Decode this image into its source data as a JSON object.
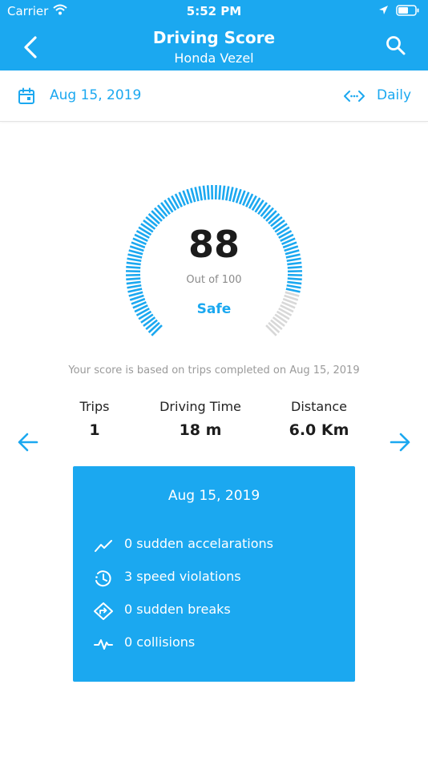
{
  "status_bar": {
    "carrier": "Carrier",
    "time": "5:52 PM"
  },
  "nav": {
    "title": "Driving Score",
    "subtitle": "Honda Vezel"
  },
  "date_bar": {
    "date": "Aug 15, 2019",
    "period": "Daily"
  },
  "score": {
    "value": "88",
    "out_of": "Out of 100",
    "rating": "Safe",
    "fraction": 0.88
  },
  "basis_text": "Your score is based on trips completed on Aug 15, 2019",
  "stats": {
    "trips_label": "Trips",
    "trips_value": "1",
    "time_label": "Driving Time",
    "time_value": "18 m",
    "distance_label": "Distance",
    "distance_value": "6.0 Km"
  },
  "summary": {
    "date": "Aug 15, 2019",
    "items": [
      {
        "icon": "trend-line-icon",
        "text": "0 sudden accelarations"
      },
      {
        "icon": "clock-alert-icon",
        "text": "3 speed violations"
      },
      {
        "icon": "turn-sign-icon",
        "text": "0 sudden breaks"
      },
      {
        "icon": "pulse-icon",
        "text": "0 collisions"
      }
    ]
  },
  "colors": {
    "accent": "#1ba8f0",
    "gauge_inactive": "#d8d8d8"
  }
}
